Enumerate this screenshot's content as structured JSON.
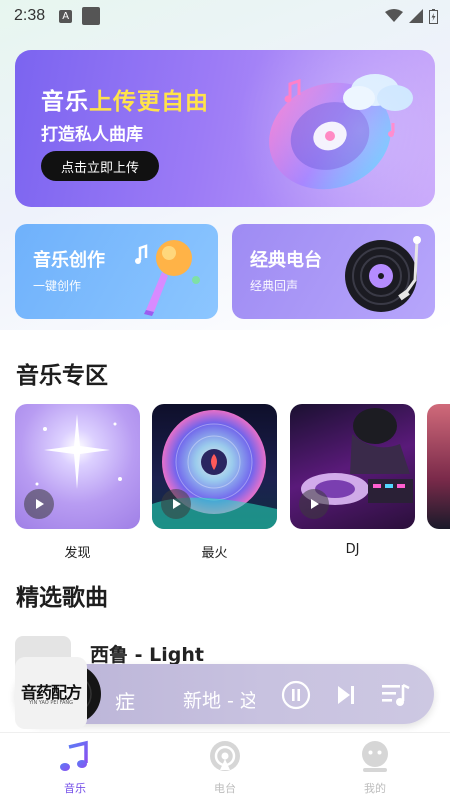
{
  "status_bar": {
    "time": "2:38",
    "notif_letter": "A"
  },
  "banner": {
    "title_part1": "音乐",
    "title_part2": "上传更自由",
    "subtitle": "打造私人曲库",
    "button_label": "点击立即上传",
    "accent_color": "#ffe34a"
  },
  "cards": [
    {
      "title": "音乐创作",
      "subtitle": "一键创作"
    },
    {
      "title": "经典电台",
      "subtitle": "经典回声"
    }
  ],
  "zone": {
    "title": "音乐专区",
    "items": [
      {
        "label": "发现"
      },
      {
        "label": "最火"
      },
      {
        "label": "DJ"
      }
    ]
  },
  "songs": {
    "title": "精选歌曲",
    "first_song_title": "西鲁 - Light"
  },
  "player": {
    "cover_text": "音药配方",
    "cover_subtext": "YIN YAO PEI FANG",
    "text_a": "症",
    "text_b": "新地 - 这"
  },
  "nav": [
    {
      "label": "音乐",
      "active": true
    },
    {
      "label": "电台",
      "active": false
    },
    {
      "label": "我的",
      "active": false
    }
  ],
  "colors": {
    "brand": "#7550e8",
    "inactive": "#bdbdbd"
  }
}
